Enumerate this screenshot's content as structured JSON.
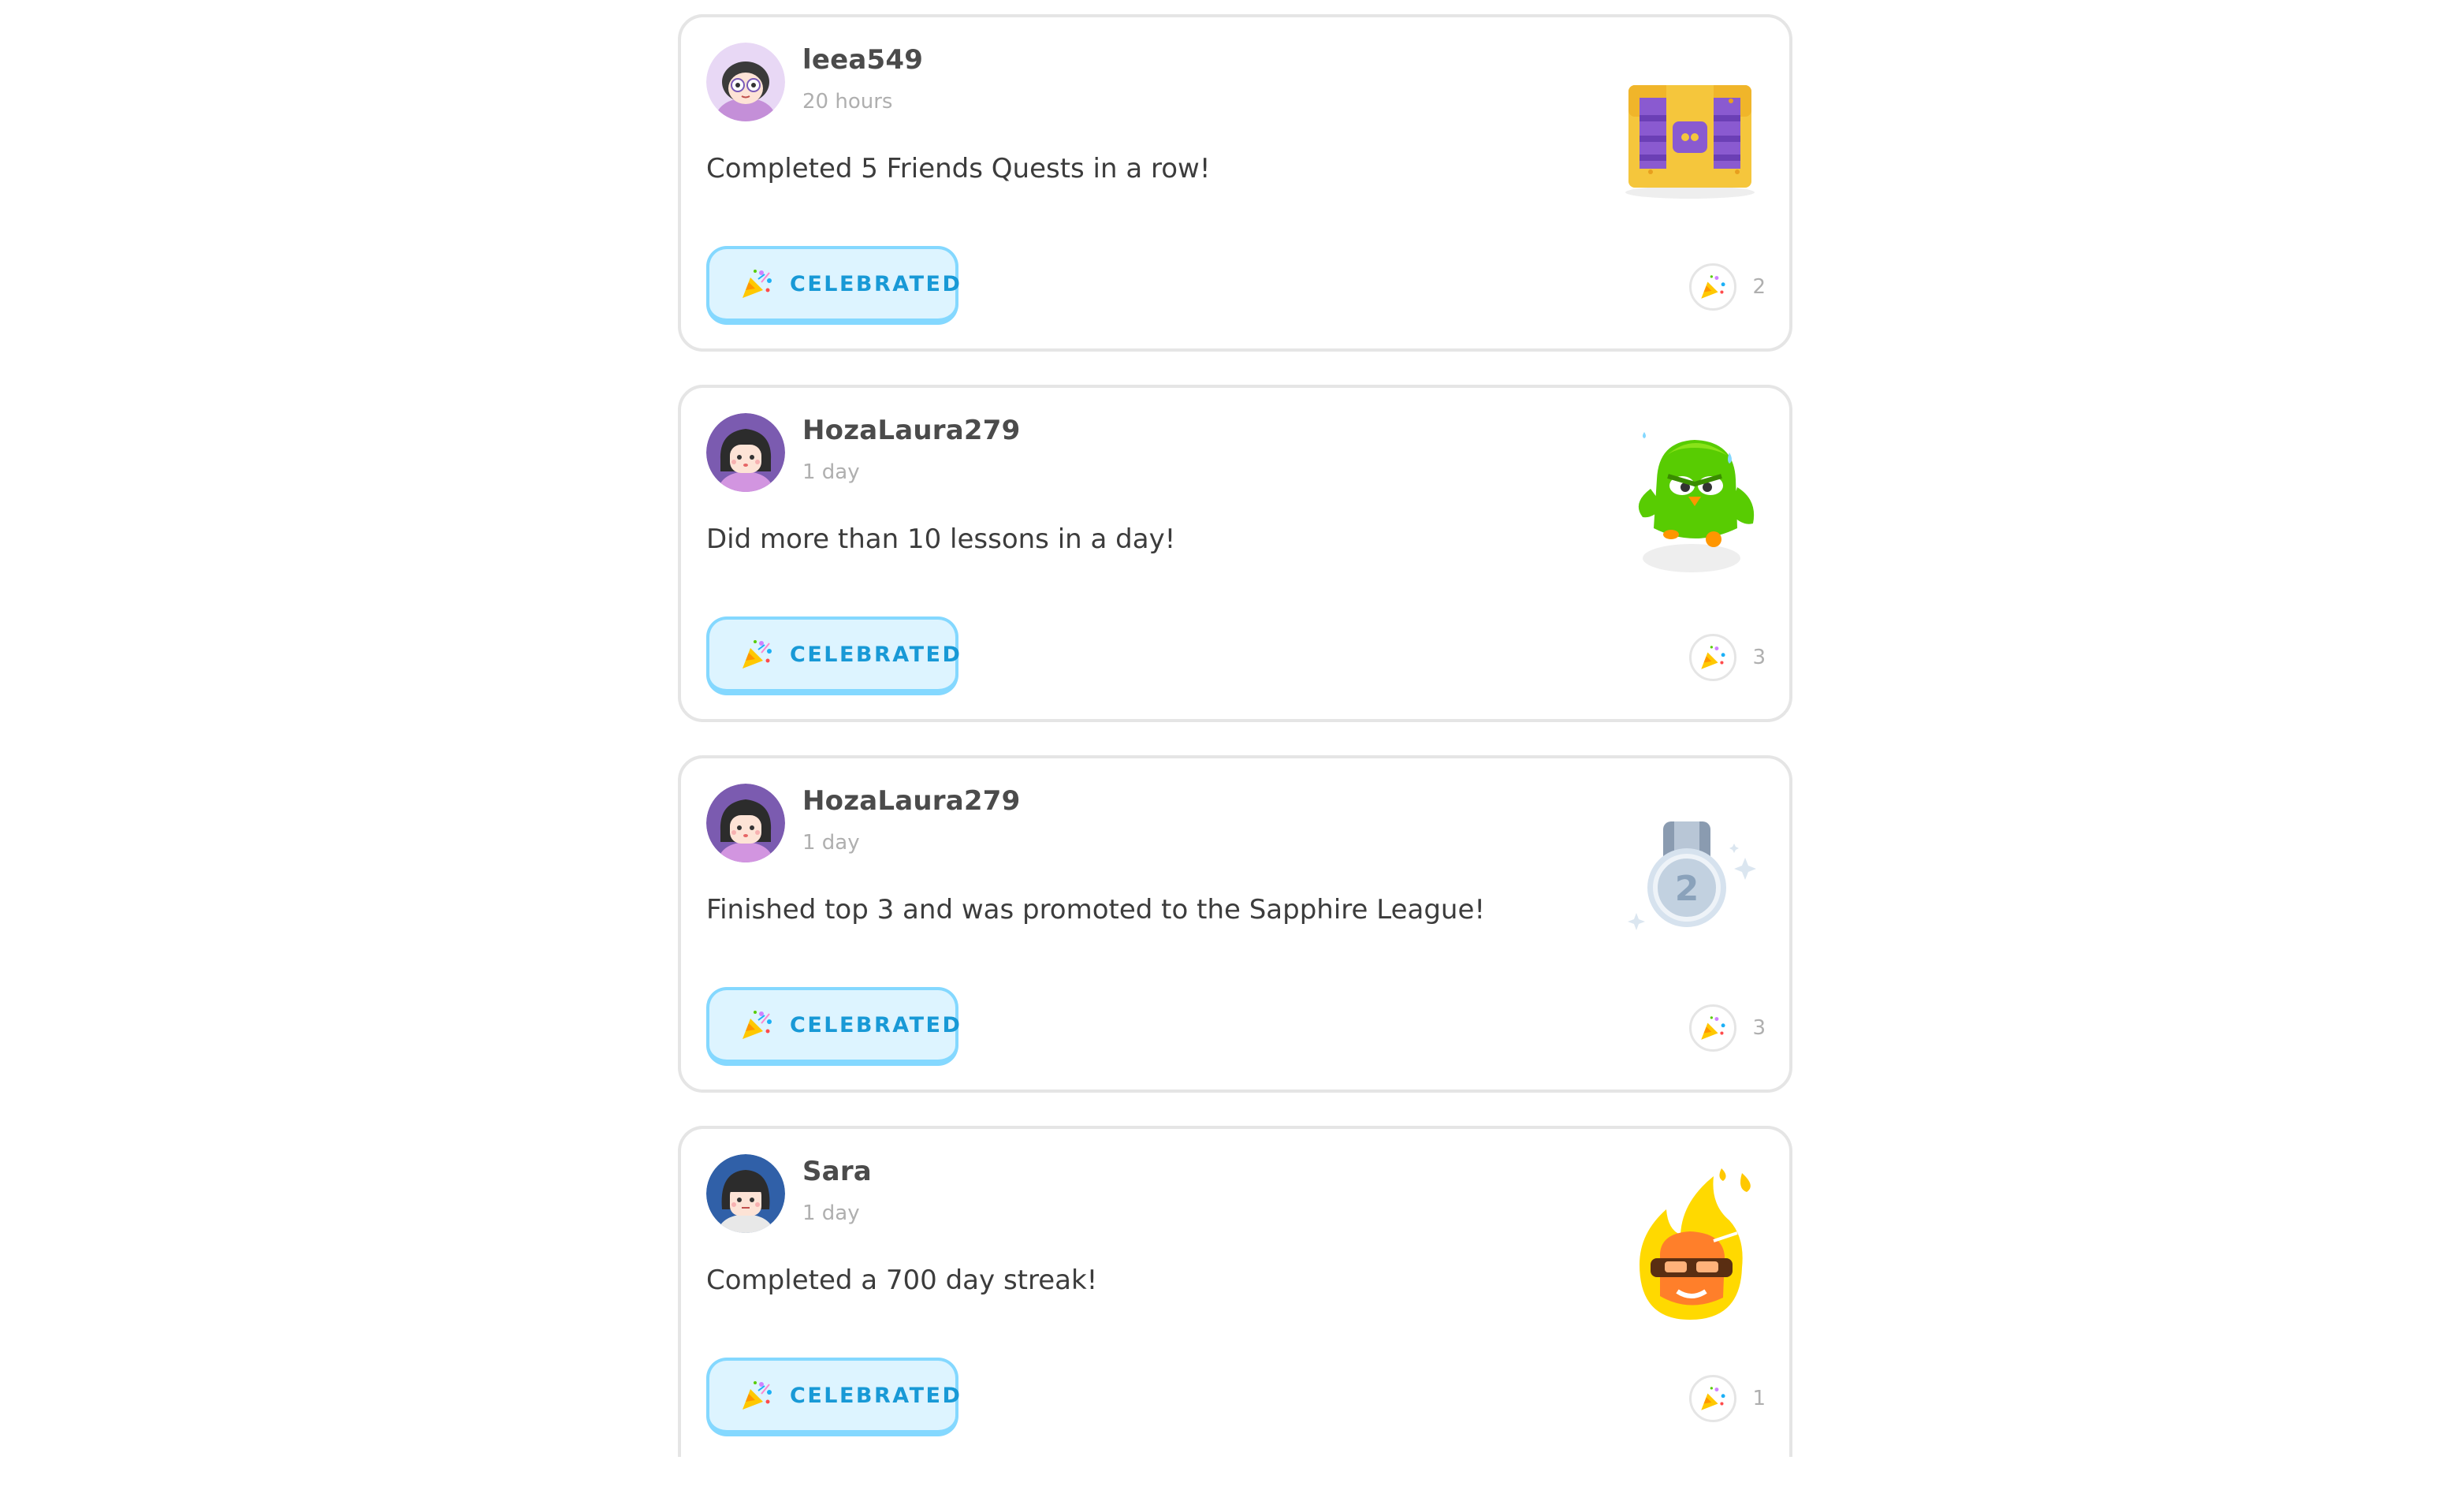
{
  "feed": {
    "items": [
      {
        "username": "leea549",
        "time": "20 hours",
        "message": "Completed 5 Friends Quests in a row!",
        "button_label": "CELEBRATED",
        "count": "2",
        "avatar_icon": "avatar-glasses-icon",
        "illustration_icon": "treasure-chest-icon"
      },
      {
        "username": "HozaLaura279",
        "time": "1 day",
        "message": "Did more than 10 lessons in a day!",
        "button_label": "CELEBRATED",
        "count": "3",
        "avatar_icon": "avatar-bob-hair-icon",
        "illustration_icon": "strong-owl-icon"
      },
      {
        "username": "HozaLaura279",
        "time": "1 day",
        "message": "Finished top 3 and was promoted to the Sapphire League!",
        "button_label": "CELEBRATED",
        "count": "3",
        "avatar_icon": "avatar-bob-hair-icon",
        "illustration_icon": "silver-medal-icon",
        "medal_number": "2"
      },
      {
        "username": "Sara",
        "time": "1 day",
        "message": "Completed a 700 day streak!",
        "button_label": "CELEBRATED",
        "count": "1",
        "avatar_icon": "avatar-bangs-icon",
        "illustration_icon": "streak-flame-icon"
      }
    ]
  },
  "colors": {
    "button_bg": "#ddf4ff",
    "button_border": "#84d8ff",
    "button_text": "#1899d6",
    "card_border": "#e5e5e5",
    "muted_text": "#afafaf"
  }
}
